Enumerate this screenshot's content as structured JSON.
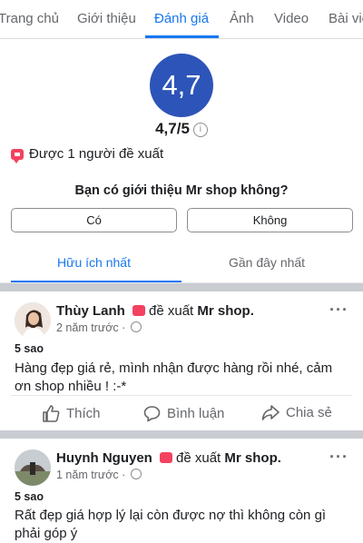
{
  "tabs": [
    "Trang chủ",
    "Giới thiệu",
    "Đánh giá",
    "Ảnh",
    "Video",
    "Bài viế"
  ],
  "active_tab": "Đánh giá",
  "rating": {
    "value": "4,7",
    "summary": "4,7/5",
    "info_glyph": "i"
  },
  "recommend_text": "Được 1 người đề xuất",
  "question": "Bạn có giới thiệu Mr shop không?",
  "answers": {
    "yes": "Có",
    "no": "Không"
  },
  "sort": {
    "helpful": "Hữu ích nhất",
    "recent": "Gần đây nhất"
  },
  "reviews": [
    {
      "name": "Thùy Lanh",
      "action": "đề xuất",
      "page": "Mr shop.",
      "time": "2 năm trước ·",
      "stars": "5 sao",
      "text": "Hàng đẹp giá rẻ, mình nhận được hàng rồi nhé, cảm ơn shop nhiều ! :-*"
    },
    {
      "name": "Huynh Nguyen",
      "action": "đề xuất",
      "page": "Mr shop.",
      "time": "1 năm trước ·",
      "stars": "5 sao",
      "text": "Rất đẹp giá hợp lý lại còn được nợ thì không còn gì phải góp ý"
    }
  ],
  "actions": {
    "like": "Thích",
    "comment": "Bình luận",
    "share": "Chia sẻ"
  },
  "more_glyph": "···",
  "colors": {
    "accent": "#1877f2",
    "rating_circle": "#2d54b8",
    "recommend_red": "#f3425f"
  }
}
